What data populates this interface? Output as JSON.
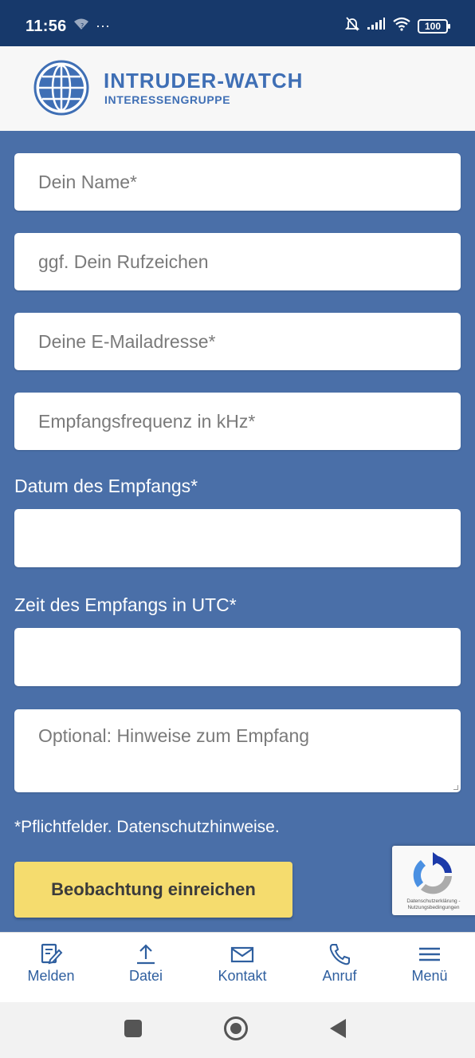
{
  "status_bar": {
    "time": "11:56",
    "dots": "···",
    "battery": "100"
  },
  "header": {
    "brand_title": "INTRUDER-WATCH",
    "brand_subtitle": "INTERESSENGRUPPE"
  },
  "form": {
    "name_placeholder": "Dein Name*",
    "callsign_placeholder": "ggf. Dein Rufzeichen",
    "email_placeholder": "Deine E-Mailadresse*",
    "frequency_placeholder": "Empfangsfrequenz in kHz*",
    "date_label": "Datum des Empfangs*",
    "date_value": "",
    "time_label": "Zeit des Empfangs in UTC*",
    "time_value": "",
    "notes_placeholder": "Optional: Hinweise zum Empfang",
    "required_note": "*Pflichtfelder. Datenschutzhinweise.",
    "submit_label": "Beobachtung einreichen"
  },
  "recaptcha": {
    "links": "Datenschutzerklärung - Nutzungsbedingungen"
  },
  "bottom_nav": {
    "items": [
      {
        "label": "Melden",
        "icon": "report-edit-icon"
      },
      {
        "label": "Datei",
        "icon": "upload-icon"
      },
      {
        "label": "Kontakt",
        "icon": "mail-icon"
      },
      {
        "label": "Anruf",
        "icon": "phone-icon"
      },
      {
        "label": "Menü",
        "icon": "hamburger-menu-icon"
      }
    ]
  },
  "colors": {
    "page_background": "#4a6fa8",
    "status_bar": "#17396b",
    "brand_blue": "#3f6fb5",
    "submit_button": "#f5dc6e"
  }
}
